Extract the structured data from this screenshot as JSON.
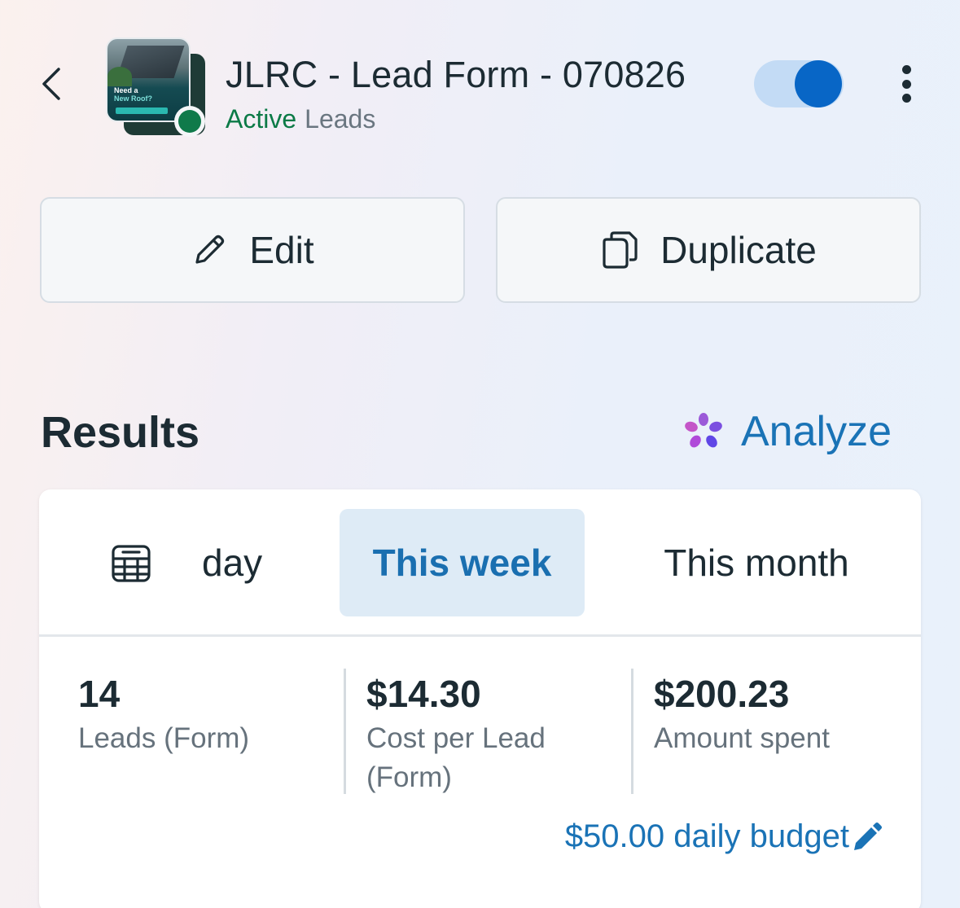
{
  "header": {
    "title": "JLRC - Lead Form - 070826",
    "status": "Active",
    "objective": "Leads",
    "thumbnail_text": [
      "Need a",
      "New Roof?"
    ],
    "toggle_on": true,
    "accent_color": "#0866c6",
    "status_color": "#0f7a4a"
  },
  "actions": {
    "edit_label": "Edit",
    "duplicate_label": "Duplicate"
  },
  "results": {
    "title": "Results",
    "analyze_label": "Analyze"
  },
  "tabs": {
    "day_label": "day",
    "week_label": "This week",
    "month_label": "This month",
    "selected": "This week"
  },
  "metrics": [
    {
      "value": "14",
      "label": "Leads (Form)"
    },
    {
      "value": "$14.30",
      "label": "Cost per Lead (Form)"
    },
    {
      "value": "$200.23",
      "label": "Amount spent"
    }
  ],
  "budget": {
    "label": "$50.00 daily budget"
  },
  "icons": [
    "chevron-left-icon",
    "more-vertical-icon",
    "pencil-icon",
    "duplicate-icon",
    "sparkle-icon",
    "calendar-icon",
    "pencil-filled-icon"
  ]
}
